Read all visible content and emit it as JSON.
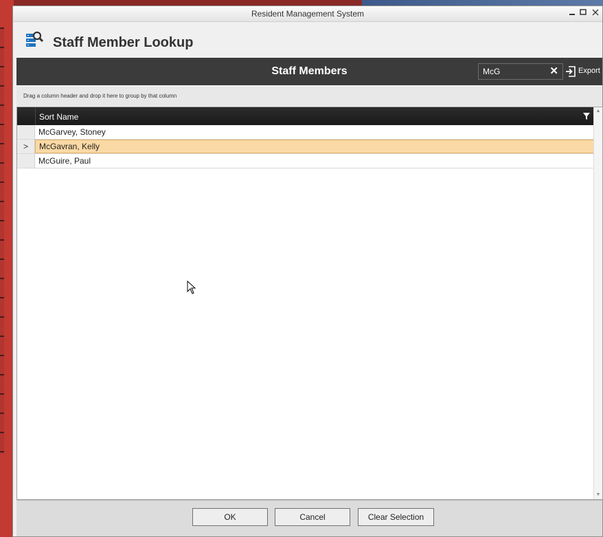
{
  "window": {
    "title": "Resident Management System"
  },
  "header": {
    "title": "Staff Member Lookup",
    "icon": "staff-lookup-icon"
  },
  "section": {
    "title": "Staff Members"
  },
  "search": {
    "value": "McG",
    "clear_label": "✕"
  },
  "export": {
    "label": "Export"
  },
  "group_panel": {
    "hint": "Drag a column header and drop it here to group by that column"
  },
  "grid": {
    "columns": [
      "Sort Name"
    ],
    "rows": [
      {
        "name": "McGarvey, Stoney",
        "indicator": ""
      },
      {
        "name": "McGavran, Kelly",
        "indicator": ">"
      },
      {
        "name": "McGuire, Paul",
        "indicator": ""
      }
    ],
    "selected_row": "McGavran, Kelly"
  },
  "buttons": {
    "ok": "OK",
    "cancel": "Cancel",
    "clear": "Clear Selection"
  },
  "colors": {
    "section_bar": "#3b3b3b",
    "selected_row": "#fbd9a4",
    "desktop_accent": "#c23a32"
  }
}
